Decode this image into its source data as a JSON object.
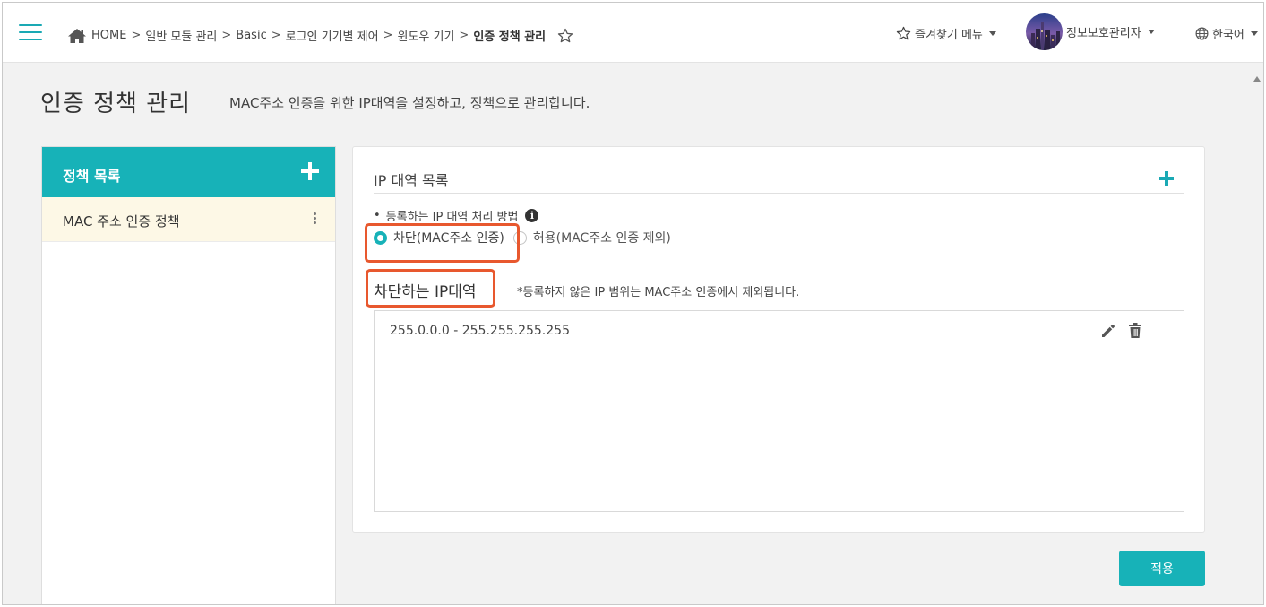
{
  "header": {
    "breadcrumb": [
      "HOME",
      "일반 모듈 관리",
      "Basic",
      "로그인 기기별 제어",
      "윈도우 기기",
      "인증 정책 관리"
    ],
    "breadcrumb_separator": ">",
    "favorites_label": "즐겨찾기 메뉴",
    "user_name": "정보보호관리자",
    "language_label": "한국어"
  },
  "page": {
    "title": "인증 정책 관리",
    "description": "MAC주소 인증을 위한 IP대역을 설정하고, 정책으로 관리합니다."
  },
  "policy_list": {
    "title": "정책 목록",
    "items": [
      {
        "label": "MAC 주소 인증 정책",
        "selected": true
      }
    ]
  },
  "ip_section": {
    "title": "IP 대역 목록",
    "method_label": "등록하는 IP 대역 처리 방법",
    "method_bullet": "•",
    "options": [
      {
        "label": "차단(MAC주소 인증)",
        "checked": true
      },
      {
        "label": "허용(MAC주소 인증 제외)",
        "checked": false
      }
    ],
    "block_title": "차단하는 IP대역",
    "block_note": "*등록하지 않은 IP 범위는 MAC주소 인증에서 제외됩니다.",
    "ranges": [
      {
        "range": "255.0.0.0 - 255.255.255.255"
      }
    ]
  },
  "apply_label": "적용",
  "colors": {
    "accent": "#17b2b8",
    "highlight": "#e8582e",
    "selected_row": "#fdf8e6"
  }
}
